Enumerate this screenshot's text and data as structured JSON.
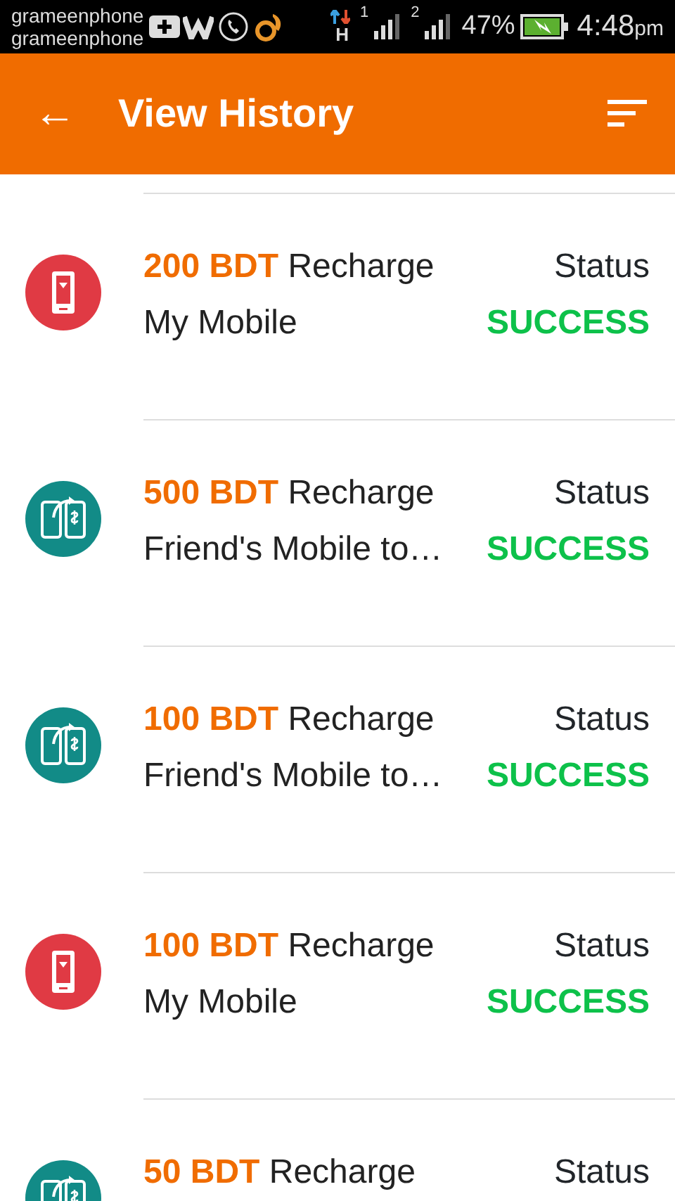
{
  "status_bar": {
    "carriers": [
      "grameenphone",
      "grameenphone"
    ],
    "sim_labels": [
      "1",
      "2"
    ],
    "network": "H",
    "battery": "47%",
    "time": "4:48",
    "time_suffix": "pm"
  },
  "app_bar": {
    "back": "←",
    "title": "View History"
  },
  "transactions": [
    {
      "kind": "self",
      "amount": "200 BDT",
      "type": "Recharge",
      "detail": "My Mobile",
      "status_label": "Status",
      "status": "SUCCESS"
    },
    {
      "kind": "friend",
      "amount": "500 BDT",
      "type": "Recharge",
      "detail": "Friend's Mobile to…",
      "status_label": "Status",
      "status": "SUCCESS"
    },
    {
      "kind": "friend",
      "amount": "100 BDT",
      "type": "Recharge",
      "detail": "Friend's Mobile to…",
      "status_label": "Status",
      "status": "SUCCESS"
    },
    {
      "kind": "self",
      "amount": "100 BDT",
      "type": "Recharge",
      "detail": "My Mobile",
      "status_label": "Status",
      "status": "SUCCESS"
    },
    {
      "kind": "friend",
      "amount": "50 BDT",
      "type": "Recharge",
      "status_label": "Status"
    }
  ]
}
